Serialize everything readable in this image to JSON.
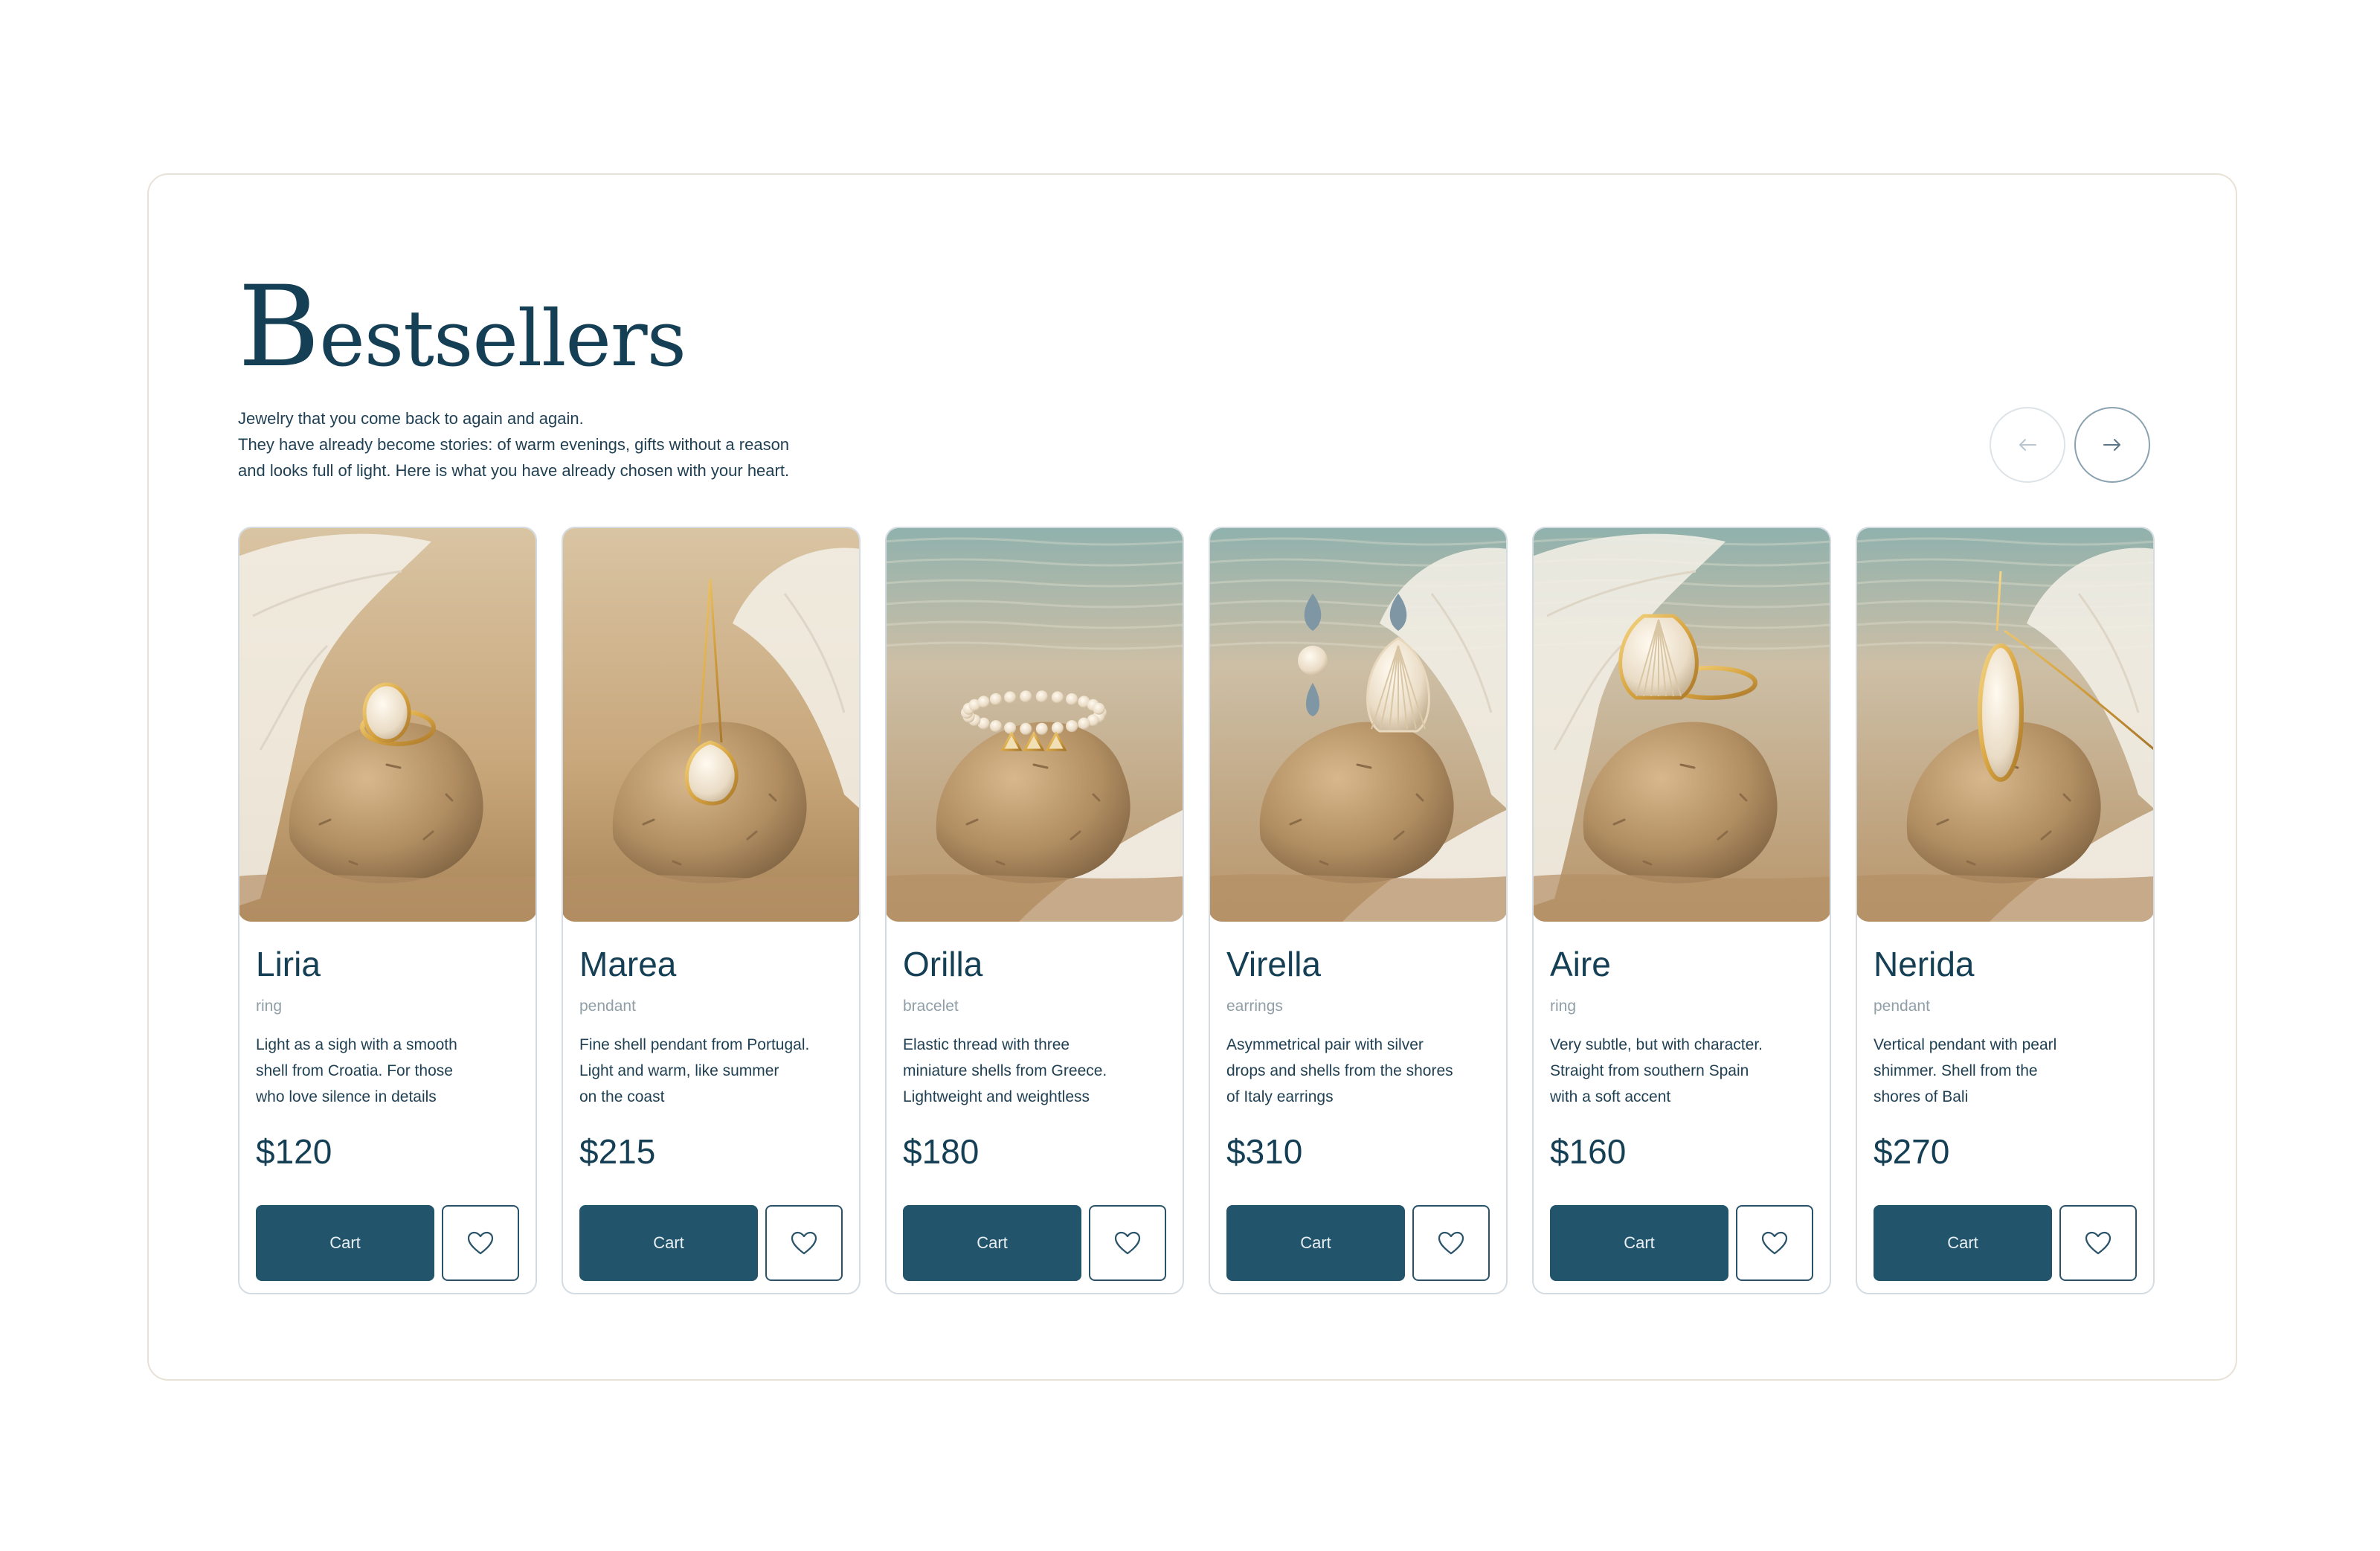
{
  "section": {
    "title_initial": "B",
    "title_rest": "estsellers",
    "subtitle_lines": [
      "Jewelry that you come back to again and again.",
      "They have already become stories: of warm evenings, gifts without a reason",
      "and looks full of light. Here is what you have already chosen with your heart."
    ]
  },
  "nav": {
    "prev_icon": "arrow-left-icon",
    "next_icon": "arrow-right-icon"
  },
  "products": [
    {
      "name": "Liria",
      "type": "ring",
      "desc_lines": [
        "Light as a sigh with a smooth",
        "shell from Croatia. For those",
        "who love silence in details"
      ],
      "price": "$120",
      "cart_label": "Cart",
      "jewel": "ring"
    },
    {
      "name": "Marea",
      "type": "pendant",
      "desc_lines": [
        "Fine shell pendant from Portugal.",
        "Light and warm, like summer",
        "on the coast"
      ],
      "price": "$215",
      "cart_label": "Cart",
      "jewel": "pendant"
    },
    {
      "name": "Orilla",
      "type": "bracelet",
      "desc_lines": [
        "Elastic thread with three",
        "miniature shells from Greece.",
        "Lightweight and weightless"
      ],
      "price": "$180",
      "cart_label": "Cart",
      "jewel": "bracelet"
    },
    {
      "name": "Virella",
      "type": "earrings",
      "desc_lines": [
        "Asymmetrical pair with silver",
        "drops and shells from the shores",
        "of Italy earrings"
      ],
      "price": "$310",
      "cart_label": "Cart",
      "jewel": "earrings"
    },
    {
      "name": "Aire",
      "type": "ring",
      "desc_lines": [
        "Very subtle, but with character.",
        "Straight from southern Spain",
        "with a soft accent"
      ],
      "price": "$160",
      "cart_label": "Cart",
      "jewel": "shell-ring"
    },
    {
      "name": "Nerida",
      "type": "pendant",
      "desc_lines": [
        "Vertical pendant with pearl",
        "shimmer. Shell from the",
        "shores of Bali"
      ],
      "price": "$270",
      "cart_label": "Cart",
      "jewel": "long-pendant"
    }
  ],
  "colors": {
    "accent": "#22546b",
    "text": "#153f55",
    "muted": "#8f9ea7",
    "border": "#d4dce2"
  }
}
